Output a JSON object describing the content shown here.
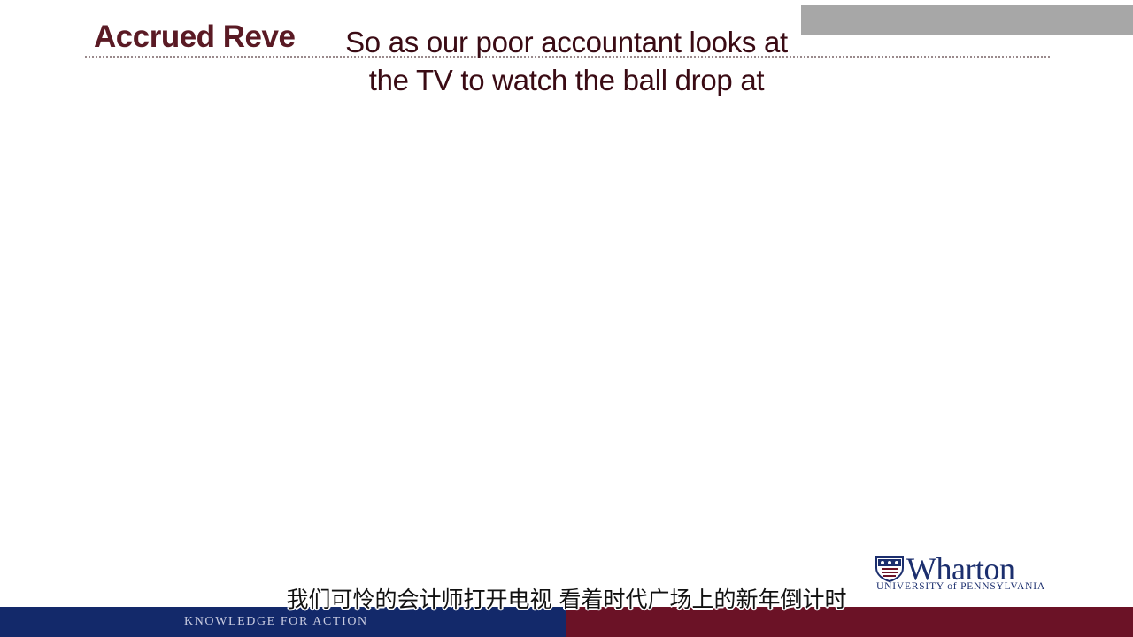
{
  "slide": {
    "title": "Accrued Reve"
  },
  "subtitles": {
    "english_line1": "So as our poor accountant looks at",
    "english_line2": "the TV to watch the ball drop at",
    "chinese": "我们可怜的会计师打开电视 看着时代广场上的新年倒计时"
  },
  "branding": {
    "logo_name": "Wharton",
    "logo_subtitle": "UNIVERSITY of PENNSYLVANIA",
    "tagline": "KNOWLEDGE FOR ACTION"
  },
  "colors": {
    "title": "#5a1a24",
    "footer_blue": "#13296a",
    "footer_red": "#6b1226",
    "logo_blue": "#1c2f6e",
    "top_right_box": "#a7a7a7"
  },
  "icons": {
    "logo": "penn-shield-icon"
  }
}
